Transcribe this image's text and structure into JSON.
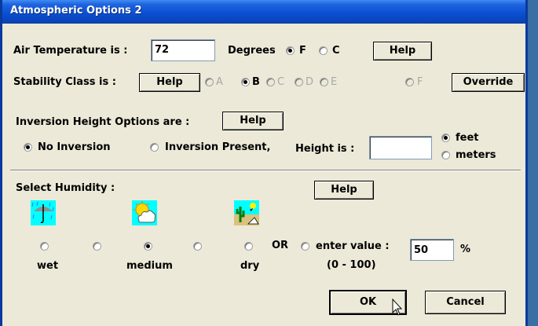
{
  "window": {
    "title": "Atmospheric Options 2"
  },
  "air": {
    "label": "Air Temperature is :",
    "value": "72",
    "units_label": "Degrees",
    "f": "F",
    "c": "C",
    "help": "Help"
  },
  "stability": {
    "label": "Stability Class is :",
    "help": "Help",
    "classes": [
      "A",
      "B",
      "C",
      "D",
      "E",
      "F"
    ],
    "selected": "B",
    "override": "Override"
  },
  "inversion": {
    "label": "Inversion Height Options are :",
    "help": "Help",
    "none": "No Inversion",
    "present": "Inversion Present,",
    "height_label": "Height is :",
    "height_value": "",
    "feet": "feet",
    "meters": "meters"
  },
  "humidity": {
    "label": "Select Humidity :",
    "help": "Help",
    "wet": "wet",
    "medium": "medium",
    "dry": "dry",
    "or": "OR",
    "enter": "enter value :",
    "value": "50",
    "pct": "%",
    "range": "(0 - 100)"
  },
  "buttons": {
    "ok": "OK",
    "cancel": "Cancel"
  },
  "icons": [
    "umbrella-rain-icon",
    "sun-cloud-icon",
    "desert-cactus-icon"
  ],
  "colors": {
    "titlebar": "#0a4fd1",
    "dialog_bg": "#ece9d8",
    "icon_bg": "#00ffff"
  }
}
